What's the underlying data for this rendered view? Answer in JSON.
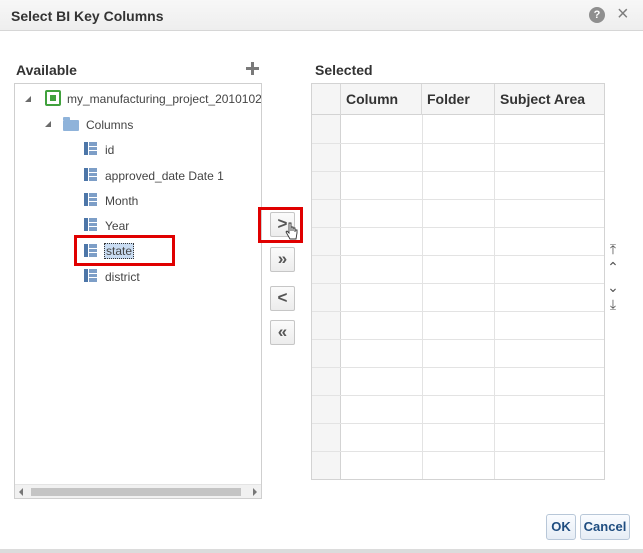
{
  "dialog": {
    "title": "Select BI Key Columns",
    "help_glyph": "?",
    "close_glyph": "×"
  },
  "available": {
    "label": "Available",
    "tree": {
      "project": "my_manufacturing_project_2010102",
      "folder": "Columns",
      "columns": [
        "id",
        "approved_date Date 1",
        "Month",
        "Year",
        "state",
        "district"
      ],
      "selected_column": "state"
    }
  },
  "shuttle": {
    "move_glyph": ">",
    "move_all_glyph": "»",
    "remove_glyph": "<",
    "remove_all_glyph": "«"
  },
  "selected": {
    "label": "Selected",
    "columns": [
      "Column",
      "Folder",
      "Subject Area"
    ],
    "rows": []
  },
  "reorder": {
    "top_glyph": "⤒",
    "up_glyph": "⌃",
    "down_glyph": "⌄",
    "bottom_glyph": "⤓"
  },
  "footer": {
    "ok_label": "OK",
    "cancel_label": "Cancel"
  },
  "colors": {
    "highlight": "#e00000",
    "selection_bg": "#c9dcf2",
    "button_text": "#1f4d80"
  }
}
